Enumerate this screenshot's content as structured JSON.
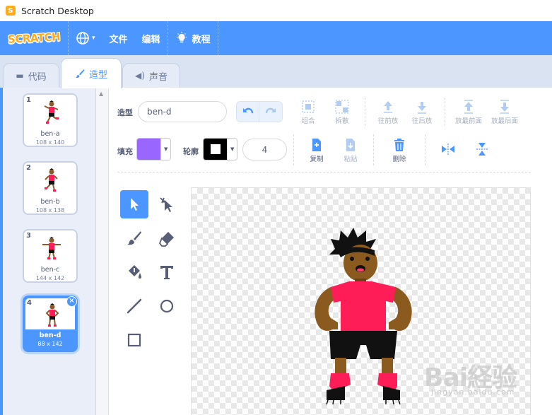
{
  "window": {
    "title": "Scratch Desktop"
  },
  "menubar": {
    "logo_text": "SCRATCH",
    "file_label": "文件",
    "edit_label": "编辑",
    "tutorials_label": "教程"
  },
  "tabs": [
    {
      "label": "代码",
      "active": false
    },
    {
      "label": "造型",
      "active": true
    },
    {
      "label": "声音",
      "active": false
    }
  ],
  "costumes": [
    {
      "number": "1",
      "name": "ben-a",
      "size": "108 x 140",
      "selected": false
    },
    {
      "number": "2",
      "name": "ben-b",
      "size": "108 x 138",
      "selected": false
    },
    {
      "number": "3",
      "name": "ben-c",
      "size": "144 x 142",
      "selected": false
    },
    {
      "number": "4",
      "name": "ben-d",
      "size": "88 x 142",
      "selected": true
    }
  ],
  "delete_glyph": "×",
  "editor": {
    "costume_label": "造型",
    "costume_name": "ben-d",
    "fill_label": "填充",
    "outline_label": "轮廓",
    "outline_width": "4",
    "fill_color": "#9966ff",
    "outline_color": "#000000",
    "toolbar": {
      "group": "组合",
      "ungroup": "拆散",
      "forward": "往前放",
      "backward": "往后放",
      "front": "放最前面",
      "back": "放最后面",
      "copy": "复制",
      "paste": "粘贴",
      "delete": "删除"
    }
  },
  "watermark": {
    "text": "Bai経验",
    "sub": "jingyan.baidu.com"
  },
  "colors": {
    "accent": "#4c97ff",
    "menubar": "#4c97ff",
    "logo": "#ffab19"
  }
}
